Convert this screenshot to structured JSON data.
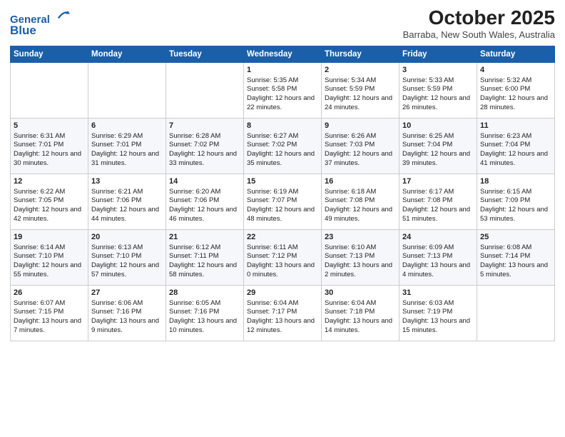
{
  "header": {
    "logo_line1": "General",
    "logo_line2": "Blue",
    "month_title": "October 2025",
    "location": "Barraba, New South Wales, Australia"
  },
  "weekdays": [
    "Sunday",
    "Monday",
    "Tuesday",
    "Wednesday",
    "Thursday",
    "Friday",
    "Saturday"
  ],
  "weeks": [
    [
      {
        "day": "",
        "sunrise": "",
        "sunset": "",
        "daylight": ""
      },
      {
        "day": "",
        "sunrise": "",
        "sunset": "",
        "daylight": ""
      },
      {
        "day": "",
        "sunrise": "",
        "sunset": "",
        "daylight": ""
      },
      {
        "day": "1",
        "sunrise": "Sunrise: 5:35 AM",
        "sunset": "Sunset: 5:58 PM",
        "daylight": "Daylight: 12 hours and 22 minutes."
      },
      {
        "day": "2",
        "sunrise": "Sunrise: 5:34 AM",
        "sunset": "Sunset: 5:59 PM",
        "daylight": "Daylight: 12 hours and 24 minutes."
      },
      {
        "day": "3",
        "sunrise": "Sunrise: 5:33 AM",
        "sunset": "Sunset: 5:59 PM",
        "daylight": "Daylight: 12 hours and 26 minutes."
      },
      {
        "day": "4",
        "sunrise": "Sunrise: 5:32 AM",
        "sunset": "Sunset: 6:00 PM",
        "daylight": "Daylight: 12 hours and 28 minutes."
      }
    ],
    [
      {
        "day": "5",
        "sunrise": "Sunrise: 6:31 AM",
        "sunset": "Sunset: 7:01 PM",
        "daylight": "Daylight: 12 hours and 30 minutes."
      },
      {
        "day": "6",
        "sunrise": "Sunrise: 6:29 AM",
        "sunset": "Sunset: 7:01 PM",
        "daylight": "Daylight: 12 hours and 31 minutes."
      },
      {
        "day": "7",
        "sunrise": "Sunrise: 6:28 AM",
        "sunset": "Sunset: 7:02 PM",
        "daylight": "Daylight: 12 hours and 33 minutes."
      },
      {
        "day": "8",
        "sunrise": "Sunrise: 6:27 AM",
        "sunset": "Sunset: 7:02 PM",
        "daylight": "Daylight: 12 hours and 35 minutes."
      },
      {
        "day": "9",
        "sunrise": "Sunrise: 6:26 AM",
        "sunset": "Sunset: 7:03 PM",
        "daylight": "Daylight: 12 hours and 37 minutes."
      },
      {
        "day": "10",
        "sunrise": "Sunrise: 6:25 AM",
        "sunset": "Sunset: 7:04 PM",
        "daylight": "Daylight: 12 hours and 39 minutes."
      },
      {
        "day": "11",
        "sunrise": "Sunrise: 6:23 AM",
        "sunset": "Sunset: 7:04 PM",
        "daylight": "Daylight: 12 hours and 41 minutes."
      }
    ],
    [
      {
        "day": "12",
        "sunrise": "Sunrise: 6:22 AM",
        "sunset": "Sunset: 7:05 PM",
        "daylight": "Daylight: 12 hours and 42 minutes."
      },
      {
        "day": "13",
        "sunrise": "Sunrise: 6:21 AM",
        "sunset": "Sunset: 7:06 PM",
        "daylight": "Daylight: 12 hours and 44 minutes."
      },
      {
        "day": "14",
        "sunrise": "Sunrise: 6:20 AM",
        "sunset": "Sunset: 7:06 PM",
        "daylight": "Daylight: 12 hours and 46 minutes."
      },
      {
        "day": "15",
        "sunrise": "Sunrise: 6:19 AM",
        "sunset": "Sunset: 7:07 PM",
        "daylight": "Daylight: 12 hours and 48 minutes."
      },
      {
        "day": "16",
        "sunrise": "Sunrise: 6:18 AM",
        "sunset": "Sunset: 7:08 PM",
        "daylight": "Daylight: 12 hours and 49 minutes."
      },
      {
        "day": "17",
        "sunrise": "Sunrise: 6:17 AM",
        "sunset": "Sunset: 7:08 PM",
        "daylight": "Daylight: 12 hours and 51 minutes."
      },
      {
        "day": "18",
        "sunrise": "Sunrise: 6:15 AM",
        "sunset": "Sunset: 7:09 PM",
        "daylight": "Daylight: 12 hours and 53 minutes."
      }
    ],
    [
      {
        "day": "19",
        "sunrise": "Sunrise: 6:14 AM",
        "sunset": "Sunset: 7:10 PM",
        "daylight": "Daylight: 12 hours and 55 minutes."
      },
      {
        "day": "20",
        "sunrise": "Sunrise: 6:13 AM",
        "sunset": "Sunset: 7:10 PM",
        "daylight": "Daylight: 12 hours and 57 minutes."
      },
      {
        "day": "21",
        "sunrise": "Sunrise: 6:12 AM",
        "sunset": "Sunset: 7:11 PM",
        "daylight": "Daylight: 12 hours and 58 minutes."
      },
      {
        "day": "22",
        "sunrise": "Sunrise: 6:11 AM",
        "sunset": "Sunset: 7:12 PM",
        "daylight": "Daylight: 13 hours and 0 minutes."
      },
      {
        "day": "23",
        "sunrise": "Sunrise: 6:10 AM",
        "sunset": "Sunset: 7:13 PM",
        "daylight": "Daylight: 13 hours and 2 minutes."
      },
      {
        "day": "24",
        "sunrise": "Sunrise: 6:09 AM",
        "sunset": "Sunset: 7:13 PM",
        "daylight": "Daylight: 13 hours and 4 minutes."
      },
      {
        "day": "25",
        "sunrise": "Sunrise: 6:08 AM",
        "sunset": "Sunset: 7:14 PM",
        "daylight": "Daylight: 13 hours and 5 minutes."
      }
    ],
    [
      {
        "day": "26",
        "sunrise": "Sunrise: 6:07 AM",
        "sunset": "Sunset: 7:15 PM",
        "daylight": "Daylight: 13 hours and 7 minutes."
      },
      {
        "day": "27",
        "sunrise": "Sunrise: 6:06 AM",
        "sunset": "Sunset: 7:16 PM",
        "daylight": "Daylight: 13 hours and 9 minutes."
      },
      {
        "day": "28",
        "sunrise": "Sunrise: 6:05 AM",
        "sunset": "Sunset: 7:16 PM",
        "daylight": "Daylight: 13 hours and 10 minutes."
      },
      {
        "day": "29",
        "sunrise": "Sunrise: 6:04 AM",
        "sunset": "Sunset: 7:17 PM",
        "daylight": "Daylight: 13 hours and 12 minutes."
      },
      {
        "day": "30",
        "sunrise": "Sunrise: 6:04 AM",
        "sunset": "Sunset: 7:18 PM",
        "daylight": "Daylight: 13 hours and 14 minutes."
      },
      {
        "day": "31",
        "sunrise": "Sunrise: 6:03 AM",
        "sunset": "Sunset: 7:19 PM",
        "daylight": "Daylight: 13 hours and 15 minutes."
      },
      {
        "day": "",
        "sunrise": "",
        "sunset": "",
        "daylight": ""
      }
    ]
  ]
}
